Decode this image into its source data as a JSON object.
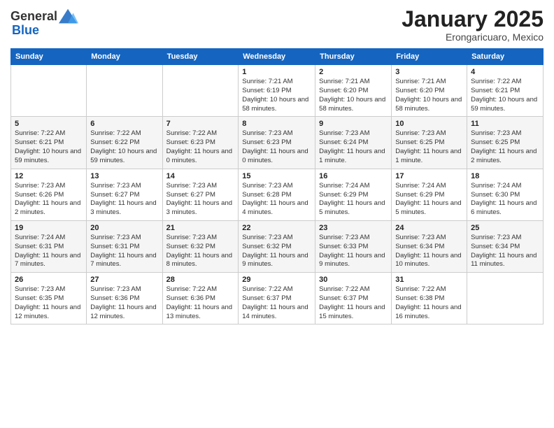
{
  "header": {
    "logo_general": "General",
    "logo_blue": "Blue",
    "month_title": "January 2025",
    "subtitle": "Erongaricuaro, Mexico"
  },
  "days_of_week": [
    "Sunday",
    "Monday",
    "Tuesday",
    "Wednesday",
    "Thursday",
    "Friday",
    "Saturday"
  ],
  "weeks": [
    [
      {
        "day": "",
        "info": ""
      },
      {
        "day": "",
        "info": ""
      },
      {
        "day": "",
        "info": ""
      },
      {
        "day": "1",
        "info": "Sunrise: 7:21 AM\nSunset: 6:19 PM\nDaylight: 10 hours and 58 minutes."
      },
      {
        "day": "2",
        "info": "Sunrise: 7:21 AM\nSunset: 6:20 PM\nDaylight: 10 hours and 58 minutes."
      },
      {
        "day": "3",
        "info": "Sunrise: 7:21 AM\nSunset: 6:20 PM\nDaylight: 10 hours and 58 minutes."
      },
      {
        "day": "4",
        "info": "Sunrise: 7:22 AM\nSunset: 6:21 PM\nDaylight: 10 hours and 59 minutes."
      }
    ],
    [
      {
        "day": "5",
        "info": "Sunrise: 7:22 AM\nSunset: 6:21 PM\nDaylight: 10 hours and 59 minutes."
      },
      {
        "day": "6",
        "info": "Sunrise: 7:22 AM\nSunset: 6:22 PM\nDaylight: 10 hours and 59 minutes."
      },
      {
        "day": "7",
        "info": "Sunrise: 7:22 AM\nSunset: 6:23 PM\nDaylight: 11 hours and 0 minutes."
      },
      {
        "day": "8",
        "info": "Sunrise: 7:23 AM\nSunset: 6:23 PM\nDaylight: 11 hours and 0 minutes."
      },
      {
        "day": "9",
        "info": "Sunrise: 7:23 AM\nSunset: 6:24 PM\nDaylight: 11 hours and 1 minute."
      },
      {
        "day": "10",
        "info": "Sunrise: 7:23 AM\nSunset: 6:25 PM\nDaylight: 11 hours and 1 minute."
      },
      {
        "day": "11",
        "info": "Sunrise: 7:23 AM\nSunset: 6:25 PM\nDaylight: 11 hours and 2 minutes."
      }
    ],
    [
      {
        "day": "12",
        "info": "Sunrise: 7:23 AM\nSunset: 6:26 PM\nDaylight: 11 hours and 2 minutes."
      },
      {
        "day": "13",
        "info": "Sunrise: 7:23 AM\nSunset: 6:27 PM\nDaylight: 11 hours and 3 minutes."
      },
      {
        "day": "14",
        "info": "Sunrise: 7:23 AM\nSunset: 6:27 PM\nDaylight: 11 hours and 3 minutes."
      },
      {
        "day": "15",
        "info": "Sunrise: 7:23 AM\nSunset: 6:28 PM\nDaylight: 11 hours and 4 minutes."
      },
      {
        "day": "16",
        "info": "Sunrise: 7:24 AM\nSunset: 6:29 PM\nDaylight: 11 hours and 5 minutes."
      },
      {
        "day": "17",
        "info": "Sunrise: 7:24 AM\nSunset: 6:29 PM\nDaylight: 11 hours and 5 minutes."
      },
      {
        "day": "18",
        "info": "Sunrise: 7:24 AM\nSunset: 6:30 PM\nDaylight: 11 hours and 6 minutes."
      }
    ],
    [
      {
        "day": "19",
        "info": "Sunrise: 7:24 AM\nSunset: 6:31 PM\nDaylight: 11 hours and 7 minutes."
      },
      {
        "day": "20",
        "info": "Sunrise: 7:23 AM\nSunset: 6:31 PM\nDaylight: 11 hours and 7 minutes."
      },
      {
        "day": "21",
        "info": "Sunrise: 7:23 AM\nSunset: 6:32 PM\nDaylight: 11 hours and 8 minutes."
      },
      {
        "day": "22",
        "info": "Sunrise: 7:23 AM\nSunset: 6:32 PM\nDaylight: 11 hours and 9 minutes."
      },
      {
        "day": "23",
        "info": "Sunrise: 7:23 AM\nSunset: 6:33 PM\nDaylight: 11 hours and 9 minutes."
      },
      {
        "day": "24",
        "info": "Sunrise: 7:23 AM\nSunset: 6:34 PM\nDaylight: 11 hours and 10 minutes."
      },
      {
        "day": "25",
        "info": "Sunrise: 7:23 AM\nSunset: 6:34 PM\nDaylight: 11 hours and 11 minutes."
      }
    ],
    [
      {
        "day": "26",
        "info": "Sunrise: 7:23 AM\nSunset: 6:35 PM\nDaylight: 11 hours and 12 minutes."
      },
      {
        "day": "27",
        "info": "Sunrise: 7:23 AM\nSunset: 6:36 PM\nDaylight: 11 hours and 12 minutes."
      },
      {
        "day": "28",
        "info": "Sunrise: 7:22 AM\nSunset: 6:36 PM\nDaylight: 11 hours and 13 minutes."
      },
      {
        "day": "29",
        "info": "Sunrise: 7:22 AM\nSunset: 6:37 PM\nDaylight: 11 hours and 14 minutes."
      },
      {
        "day": "30",
        "info": "Sunrise: 7:22 AM\nSunset: 6:37 PM\nDaylight: 11 hours and 15 minutes."
      },
      {
        "day": "31",
        "info": "Sunrise: 7:22 AM\nSunset: 6:38 PM\nDaylight: 11 hours and 16 minutes."
      },
      {
        "day": "",
        "info": ""
      }
    ]
  ]
}
